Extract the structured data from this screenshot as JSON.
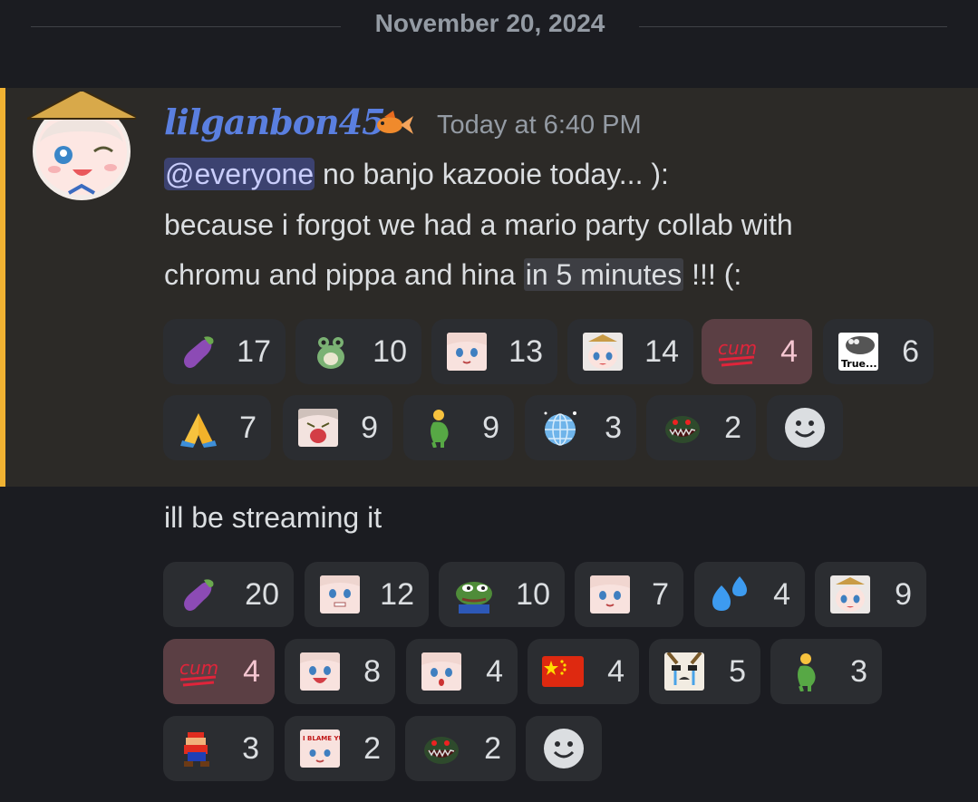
{
  "divider": {
    "date": "November 20, 2024"
  },
  "message1": {
    "username": "lilganbon45",
    "timestamp": "Today at 6:40 PM",
    "mention": "@everyone",
    "line1_rest": " no banjo kazooie today... ):",
    "line2": "because i forgot we had a mario party collab with",
    "line3_pre": "chromu and pippa and hina ",
    "line3_hl": "in 5 minutes",
    "line3_post": " !!! (:",
    "reactions": [
      {
        "icon": "eggplant-icon",
        "count": "17"
      },
      {
        "icon": "frog-plush-icon",
        "count": "10"
      },
      {
        "icon": "anime-face-icon",
        "count": "13"
      },
      {
        "icon": "anime-hat-face-icon",
        "count": "14"
      },
      {
        "icon": "cum-100-icon",
        "label": "cum",
        "count": "4",
        "selected": true
      },
      {
        "icon": "true-seal-icon",
        "label": "True...",
        "count": "6"
      },
      {
        "icon": "folded-hands-icon",
        "count": "7"
      },
      {
        "icon": "anime-crying-icon",
        "count": "9"
      },
      {
        "icon": "pregnant-man-icon",
        "count": "9"
      },
      {
        "icon": "mirror-ball-icon",
        "count": "3"
      },
      {
        "icon": "piranha-fish-icon",
        "count": "2"
      }
    ]
  },
  "message2": {
    "text": "ill be streaming it",
    "reactions": [
      {
        "icon": "eggplant-icon",
        "count": "20"
      },
      {
        "icon": "anime-grin-icon",
        "count": "12"
      },
      {
        "icon": "pepe-icon",
        "count": "10"
      },
      {
        "icon": "anime-face-icon",
        "count": "7"
      },
      {
        "icon": "sweat-droplets-icon",
        "count": "4"
      },
      {
        "icon": "anime-hat-face-icon",
        "count": "9"
      },
      {
        "icon": "cum-100-icon",
        "label": "cum",
        "count": "4",
        "selected": true
      },
      {
        "icon": "anime-laugh-icon",
        "count": "8"
      },
      {
        "icon": "anime-shocked-icon",
        "count": "4"
      },
      {
        "icon": "china-flag-icon",
        "count": "4"
      },
      {
        "icon": "crying-meme-icon",
        "count": "5"
      },
      {
        "icon": "pregnant-man-icon",
        "count": "3"
      },
      {
        "icon": "mario-sprite-icon",
        "count": "3"
      },
      {
        "icon": "blame-yuuko-icon",
        "label": "I BLAME YUUKO?",
        "count": "2"
      },
      {
        "icon": "piranha-fish-icon",
        "count": "2"
      }
    ]
  },
  "colors": {
    "background": "#1b1c21",
    "highlight_bg": "#2c2a27",
    "highlight_bar": "#f0b232",
    "username": "#5a7fe0",
    "mention_bg": "#3c4270",
    "reaction_bg": "#2b2d31",
    "reaction_selected_bg": "#5b3f44"
  }
}
